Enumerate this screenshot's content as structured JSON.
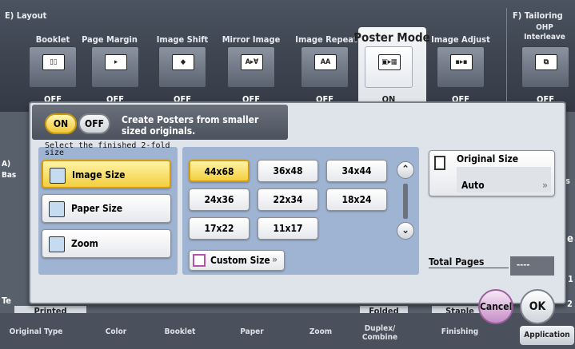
{
  "sections": {
    "layout": "E) Layout",
    "tailoring": "F) Tailoring"
  },
  "functions": [
    {
      "label": "Booklet",
      "state": "OFF"
    },
    {
      "label": "Page Margin",
      "state": "OFF"
    },
    {
      "label": "Image Shift",
      "state": "OFF"
    },
    {
      "label": "Mirror Image",
      "state": "OFF"
    },
    {
      "label": "Image Repeat",
      "state": "OFF"
    },
    {
      "label": "Poster Mode",
      "state": "ON"
    },
    {
      "label": "Image Adjust",
      "state": "OFF"
    },
    {
      "label": "OHP Interleave",
      "state": "OFF"
    }
  ],
  "dialog": {
    "on_label": "ON",
    "off_label": "OFF",
    "description": "Create Posters from smaller sized originals.",
    "finished_size_label": "Select the finished 2-fold size",
    "size_methods": [
      "Image Size",
      "Paper Size",
      "Zoom"
    ],
    "sizes": [
      "44x68",
      "36x48",
      "34x44",
      "24x36",
      "22x34",
      "18x24",
      "17x22",
      "11x17"
    ],
    "custom_size": "Custom Size",
    "original_size_label": "Original Size",
    "original_size_value": "Auto",
    "total_pages_label": "Total Pages",
    "total_pages_value": "----",
    "cancel": "Cancel",
    "ok": "OK"
  },
  "background_bits": {
    "a_label": "A)",
    "bas": "Bas",
    "te": "Te",
    "printed": "Printed",
    "folded": "Folded",
    "staple": "Staple",
    "e": "e",
    "one": "1",
    "two": "2",
    "s": "s"
  },
  "tabs": [
    "Original Type",
    "Color",
    "Booklet",
    "Paper",
    "Zoom",
    "Duplex/ Combine",
    "Finishing",
    "Application"
  ]
}
